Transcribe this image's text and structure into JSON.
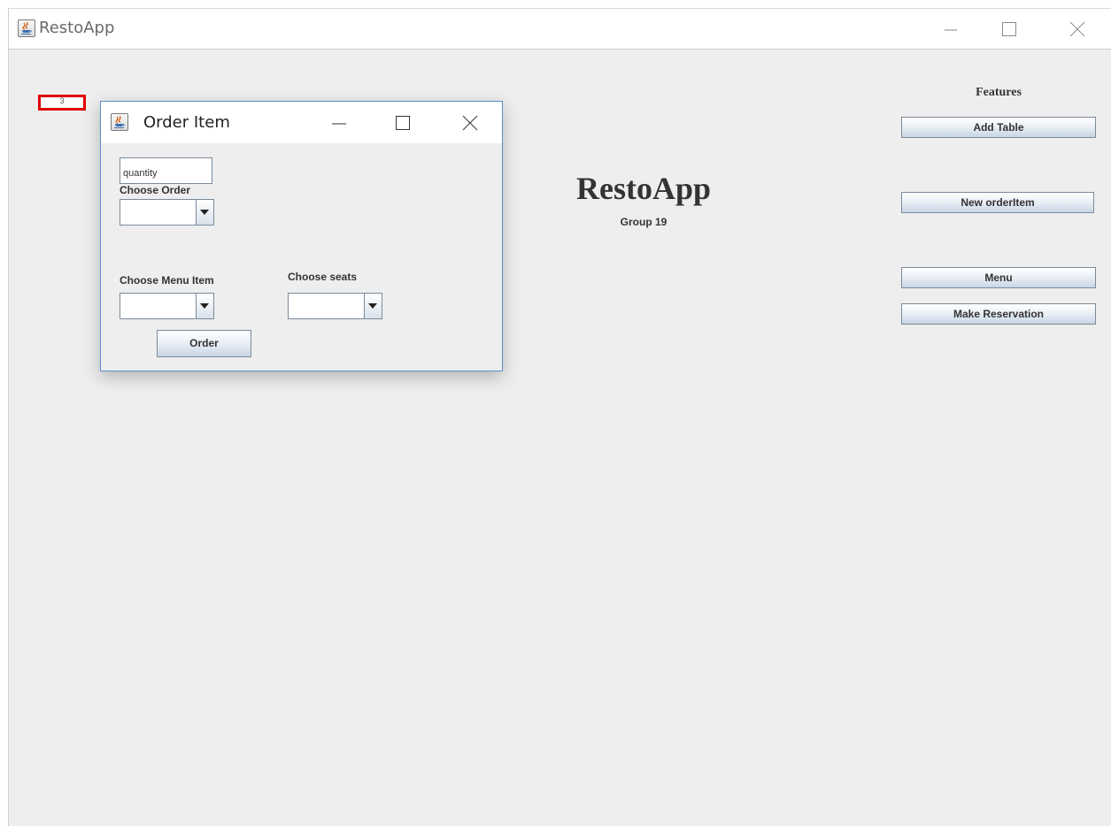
{
  "main_window": {
    "title": "RestoApp",
    "icon": "java-cup-icon"
  },
  "window_controls": {
    "minimize": "minimize-icon",
    "maximize": "maximize-icon",
    "close": "close-icon"
  },
  "selection_box": {
    "value": "3",
    "border_color": "#e00000"
  },
  "center": {
    "brand": "RestoApp",
    "subtitle": "Group 19"
  },
  "features": {
    "heading": "Features",
    "buttons": [
      "Add Table",
      "New orderItem",
      "Menu",
      "Make Reservation"
    ]
  },
  "dialog": {
    "title": "Order Item",
    "icon": "java-cup-icon",
    "quantity_value": "quantity",
    "choose_order_label": "Choose Order",
    "choose_order_value": "",
    "choose_menu_item_label": "Choose Menu Item",
    "choose_menu_item_value": "",
    "choose_seats_label": "Choose seats",
    "choose_seats_value": "",
    "order_button": "Order",
    "border_color": "#5a8ecb"
  },
  "colors": {
    "background": "#eeeeee",
    "button_border": "#7a8a99",
    "text": "#333333"
  }
}
